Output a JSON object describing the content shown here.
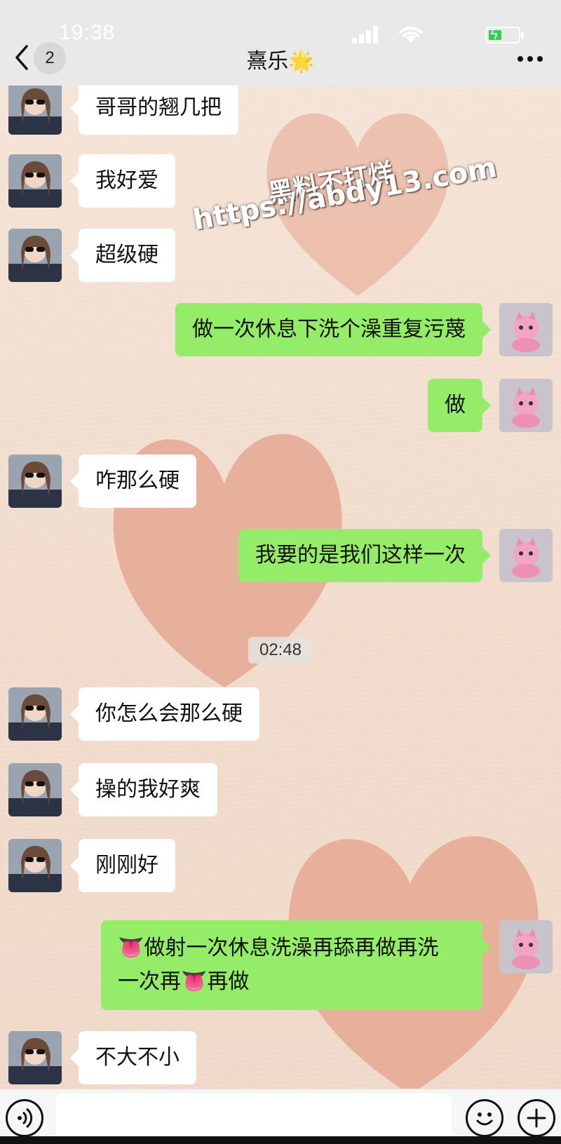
{
  "status_bar": {
    "time": "19:38"
  },
  "header": {
    "unread_count": "2",
    "contact_name": "熹乐",
    "title_emoji": "🌟"
  },
  "watermark": {
    "line1": "黑料不打烊",
    "line2": "https://abdy13.com"
  },
  "messages": [
    {
      "side": "in",
      "text": "哥哥的翘几把"
    },
    {
      "side": "in",
      "text": "我好爱"
    },
    {
      "side": "in",
      "text": "超级硬"
    },
    {
      "side": "out",
      "text": "做一次休息下洗个澡重复污蔑"
    },
    {
      "side": "out",
      "text": "做"
    },
    {
      "side": "in",
      "text": "咋那么硬"
    },
    {
      "side": "out",
      "text": "我要的是我们这样一次"
    },
    {
      "side": "in",
      "text": "你怎么会那么硬"
    },
    {
      "side": "in",
      "text": "操的我好爽"
    },
    {
      "side": "in",
      "text": "刚刚好"
    },
    {
      "side": "out",
      "text_line1": "👅做射一次休息洗澡再舔再做再洗",
      "text_line2": "一次再👅再做"
    },
    {
      "side": "in",
      "text": "不大不小"
    }
  ],
  "timestamp_divider": "02:48",
  "colors": {
    "outgoing_bubble": "#95ec69",
    "incoming_bubble": "#ffffff",
    "header_bg": "#e9e9e9",
    "chat_bg": "#f3e1d3"
  },
  "icons": {
    "back": "chevron-left-icon",
    "more": "more-dots-icon",
    "voice": "voice-icon",
    "emoji": "emoji-icon",
    "plus": "plus-icon"
  }
}
